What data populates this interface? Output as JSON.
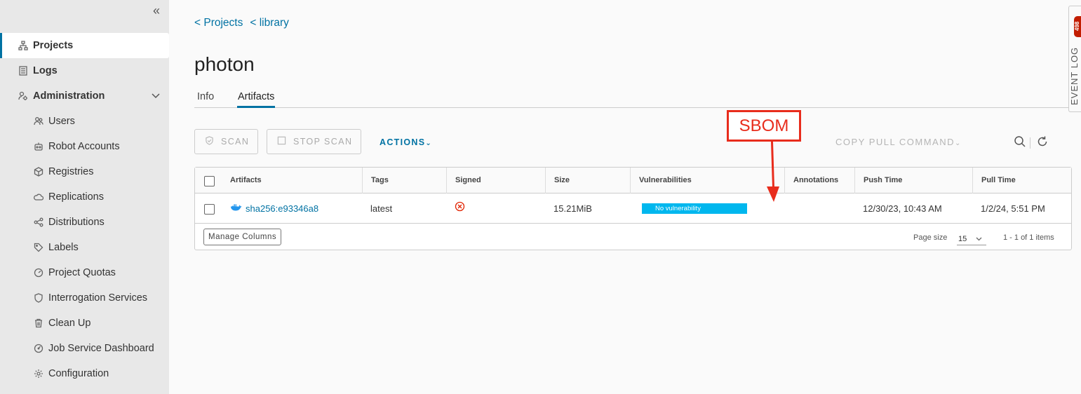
{
  "sidebar": {
    "items": [
      {
        "label": "Projects",
        "icon": "projects-icon"
      },
      {
        "label": "Logs",
        "icon": "logs-icon"
      },
      {
        "label": "Administration",
        "icon": "administration-icon"
      }
    ],
    "admin_items": [
      {
        "label": "Users",
        "icon": "users-icon"
      },
      {
        "label": "Robot Accounts",
        "icon": "robot-icon"
      },
      {
        "label": "Registries",
        "icon": "registries-icon"
      },
      {
        "label": "Replications",
        "icon": "replications-icon"
      },
      {
        "label": "Distributions",
        "icon": "distributions-icon"
      },
      {
        "label": "Labels",
        "icon": "labels-icon"
      },
      {
        "label": "Project Quotas",
        "icon": "quotas-icon"
      },
      {
        "label": "Interrogation Services",
        "icon": "shield-icon"
      },
      {
        "label": "Clean Up",
        "icon": "trash-icon"
      },
      {
        "label": "Job Service Dashboard",
        "icon": "dashboard-icon"
      },
      {
        "label": "Configuration",
        "icon": "gear-icon"
      }
    ]
  },
  "breadcrumb": [
    "< Projects",
    "< library"
  ],
  "page": {
    "title": "photon"
  },
  "tabs": [
    {
      "label": "Info"
    },
    {
      "label": "Artifacts",
      "active": true
    }
  ],
  "toolbar": {
    "scan_label": "SCAN",
    "stop_scan_label": "STOP SCAN",
    "actions_label": "ACTIONS",
    "copy_pull_label": "COPY PULL COMMAND"
  },
  "table": {
    "columns": [
      "Artifacts",
      "Tags",
      "Signed",
      "Size",
      "Vulnerabilities",
      "Annotations",
      "Push Time",
      "Pull Time"
    ],
    "rows": [
      {
        "artifact": "sha256:e93346a8",
        "tags": "latest",
        "signed": false,
        "size": "15.21MiB",
        "vulnerabilities": "No vulnerability",
        "annotations": "",
        "push_time": "12/30/23, 10:43 AM",
        "pull_time": "1/2/24, 5:51 PM"
      }
    ],
    "manage_columns_label": "Manage Columns",
    "page_size_label": "Page size",
    "page_size": "15",
    "count_label": "1 - 1 of 1 items"
  },
  "annotation": {
    "label": "SBOM"
  },
  "event_log": {
    "label": "EVENT LOG",
    "badge": "498"
  },
  "colors": {
    "accent": "#0072a3",
    "vuln_bar": "#00b7ee",
    "annotation_red": "#e82c1c",
    "badge_red": "#c21d00"
  }
}
